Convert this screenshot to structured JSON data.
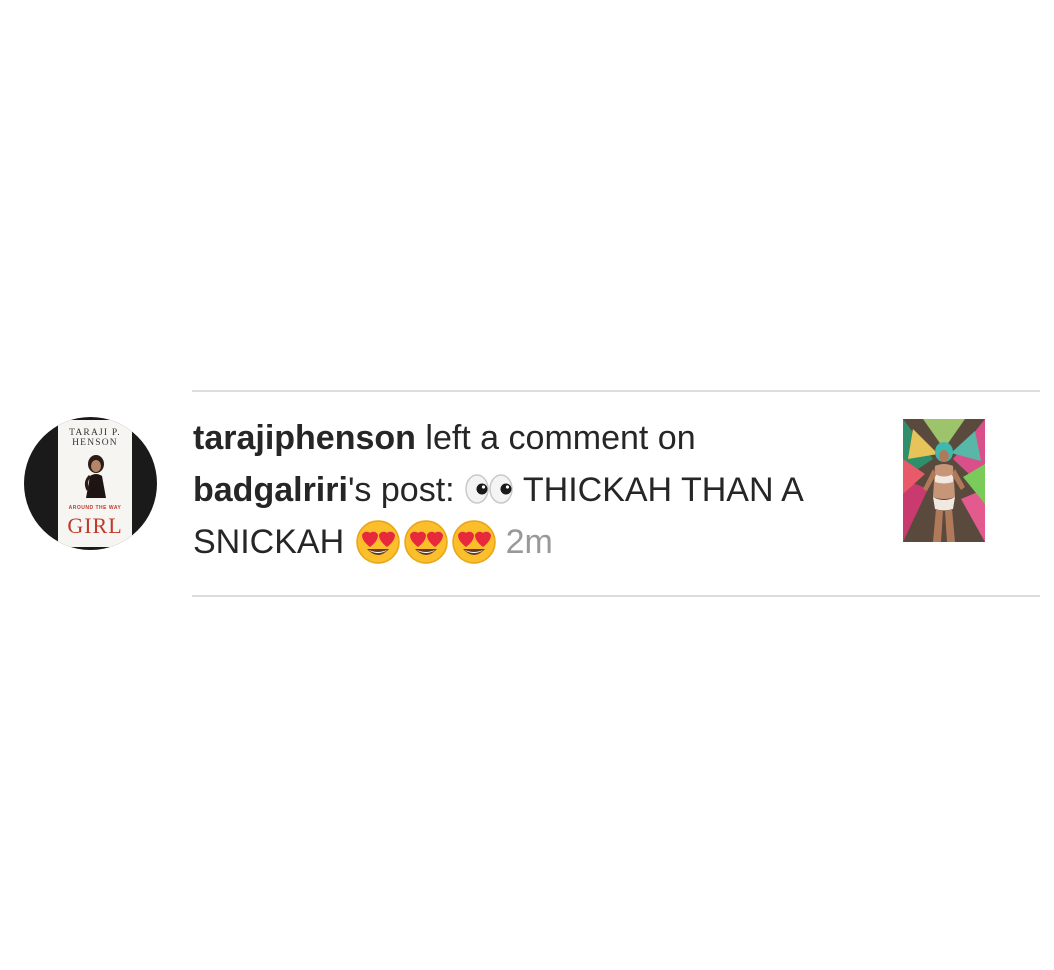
{
  "notification": {
    "actor_username": "tarajiphenson",
    "action_text": " left a comment on ",
    "target_username": "badgalriri",
    "possessive_suffix": "'s post: ",
    "comment_part1": " THICKAH THAN A SNICKAH ",
    "emojis": {
      "eyes": "eyes-emoji",
      "hearts": [
        "heart-eyes-emoji",
        "heart-eyes-emoji",
        "heart-eyes-emoji"
      ]
    },
    "timestamp": "2m"
  },
  "avatar": {
    "book_author_line1": "TARAJI P.",
    "book_author_line2": "HENSON",
    "book_subtitle": "AROUND THE WAY",
    "book_title": "GIRL"
  },
  "colors": {
    "text": "#262626",
    "timestamp": "#999999",
    "divider": "#dddddd",
    "book_accent": "#c0392b"
  }
}
